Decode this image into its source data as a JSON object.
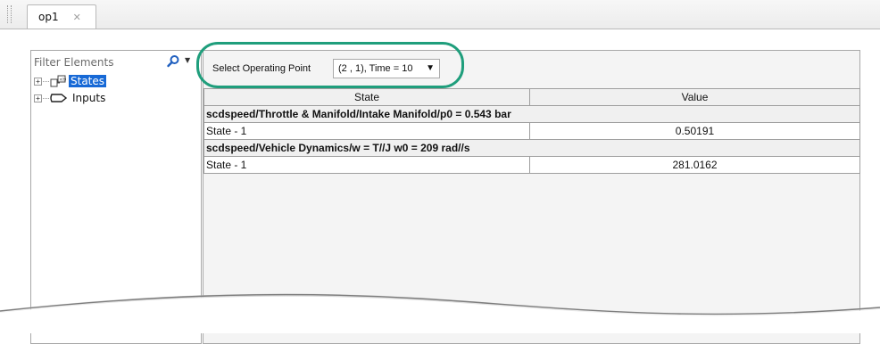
{
  "tab": {
    "label": "op1",
    "close_glyph": "✕"
  },
  "filter": {
    "placeholder": "Filter Elements"
  },
  "tree": {
    "items": [
      {
        "label": "States",
        "icon": "states-icon",
        "selected": true
      },
      {
        "label": "Inputs",
        "icon": "inputs-icon",
        "selected": false
      }
    ]
  },
  "operating_point": {
    "label": "Select Operating Point",
    "selected": "(2 , 1), Time = 10"
  },
  "table": {
    "headers": [
      "State",
      "Value"
    ],
    "groups": [
      {
        "title": "scdspeed/Throttle & Manifold/Intake Manifold/p0 = 0.543 bar",
        "rows": [
          {
            "name": "State - 1",
            "value": "0.50191"
          }
        ]
      },
      {
        "title": "scdspeed/Vehicle Dynamics/w = T//J w0 = 209 rad//s",
        "rows": [
          {
            "name": "State - 1",
            "value": "281.0162"
          }
        ]
      }
    ]
  },
  "colors": {
    "highlight": "#1f9e7c",
    "selection": "#1769d6"
  }
}
